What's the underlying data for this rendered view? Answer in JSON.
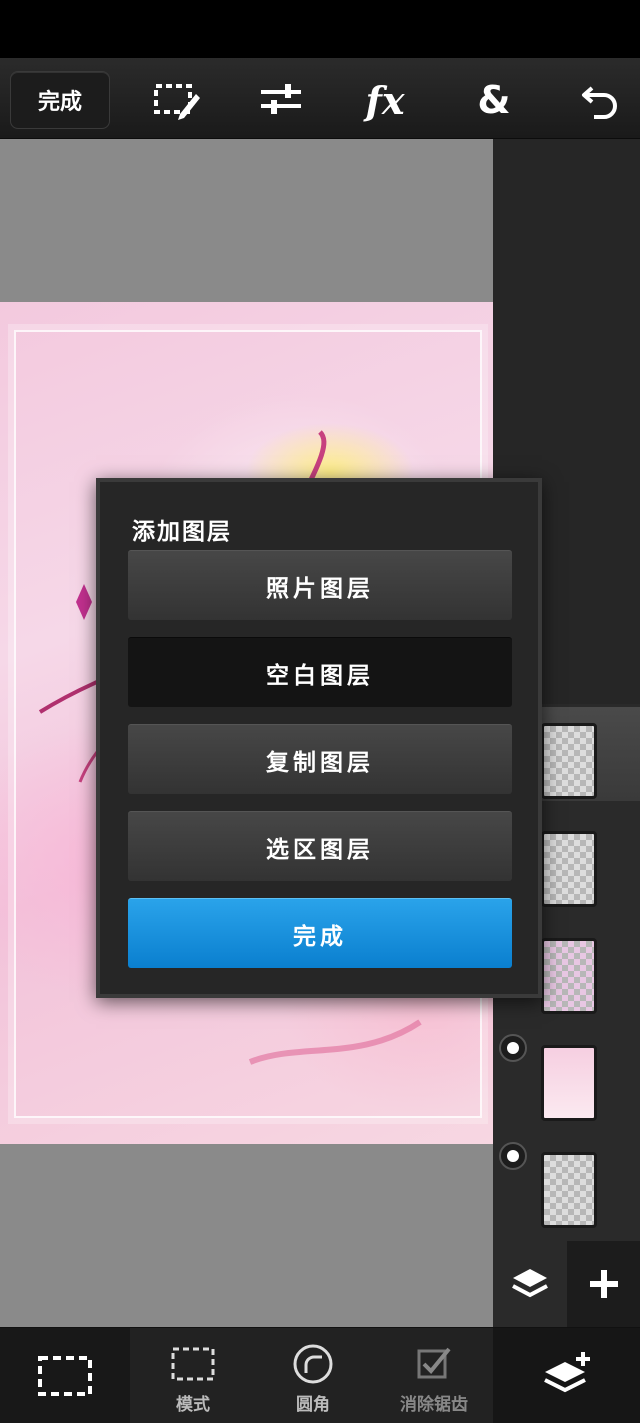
{
  "toolbar": {
    "done_label": "完成",
    "icons": [
      "selection-edit-icon",
      "adjust-sliders-icon",
      "fx-icon",
      "ampersand-icon",
      "undo-icon"
    ],
    "fx_label": "fx",
    "amp_label": "&"
  },
  "dialog": {
    "title": "添加图层",
    "options": [
      "照片图层",
      "空白图层",
      "复制图层",
      "选区图层"
    ],
    "confirm_label": "完成",
    "pressed_option_index": 1
  },
  "bottom_toolbar": {
    "items": [
      {
        "label": "",
        "icon": "rectangle-select-icon"
      },
      {
        "label": "模式",
        "icon": "selection-mode-icon"
      },
      {
        "label": "圆角",
        "icon": "round-corner-icon"
      },
      {
        "label": "消除锯齿",
        "icon": "antialias-check-icon"
      }
    ]
  },
  "layers": {
    "count": 5,
    "visible_dots": [
      4,
      5
    ],
    "selected_index": 1
  },
  "colors": {
    "accent": "#1a90dc",
    "toolbar_bg": "#222222",
    "canvas_bg": "#8a8a8a"
  }
}
